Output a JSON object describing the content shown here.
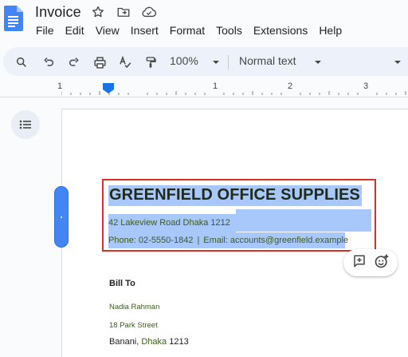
{
  "app": {
    "title": "Invoice",
    "brand_color": "#4285f4"
  },
  "header_icons": [
    "star-icon",
    "move-to-folder-icon",
    "cloud-status-icon"
  ],
  "menu": [
    "File",
    "Edit",
    "View",
    "Insert",
    "Format",
    "Tools",
    "Extensions",
    "Help"
  ],
  "toolbar": {
    "zoom": "100%",
    "style": "Normal text",
    "icons": [
      "search-icon",
      "undo-icon",
      "redo-icon",
      "print-icon",
      "spellcheck-icon",
      "paint-format-icon"
    ]
  },
  "ruler": {
    "marks": [
      "1",
      "1",
      "2",
      "3"
    ]
  },
  "document": {
    "company": "GREENFIELD OFFICE SUPPLIES",
    "address": "42 Lakeview Road  Dhaka 1212",
    "phone": "Phone: 02-5550-1842",
    "separator": "|",
    "email": "Email: accounts@greenfield.example",
    "bill_to": {
      "title": "Bill To",
      "name": "Nadia Rahman",
      "street": "18 Park Street",
      "area": "Banani, ",
      "city": "Dhaka",
      "zip": " 1213"
    }
  },
  "colors": {
    "selection": "#a8c7fa",
    "focus_outline": "#d93025",
    "toolbar_bg": "#edf2fa"
  }
}
